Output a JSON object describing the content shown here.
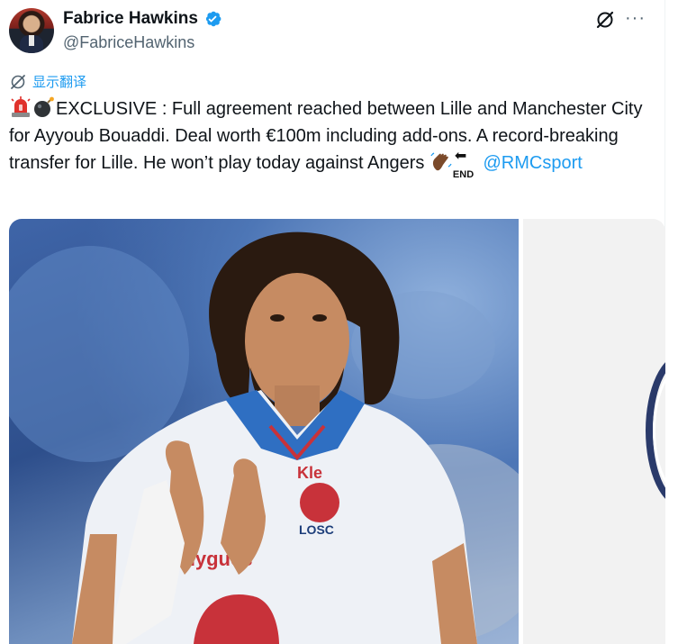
{
  "tweet": {
    "author": {
      "display_name": "Fabrice Hawkins",
      "handle": "@FabriceHawkins",
      "verified": true
    },
    "translate_label": "显示翻译",
    "text_part1": "EXCLUSIVE : Full agreement reached between Lille and Manchester City for Ayyoub Bouaddi. Deal worth €100m including add-ons. A record-breaking transfer for Lille. He won’t play today against Angers ",
    "end_emoji_text": "END",
    "mention": "@RMCsport",
    "emojis": [
      "rotating-light",
      "bomb",
      "waving-hand",
      "end-arrow"
    ]
  },
  "colors": {
    "accent": "#1d9bf0",
    "text": "#0f1419",
    "muted": "#536471"
  }
}
